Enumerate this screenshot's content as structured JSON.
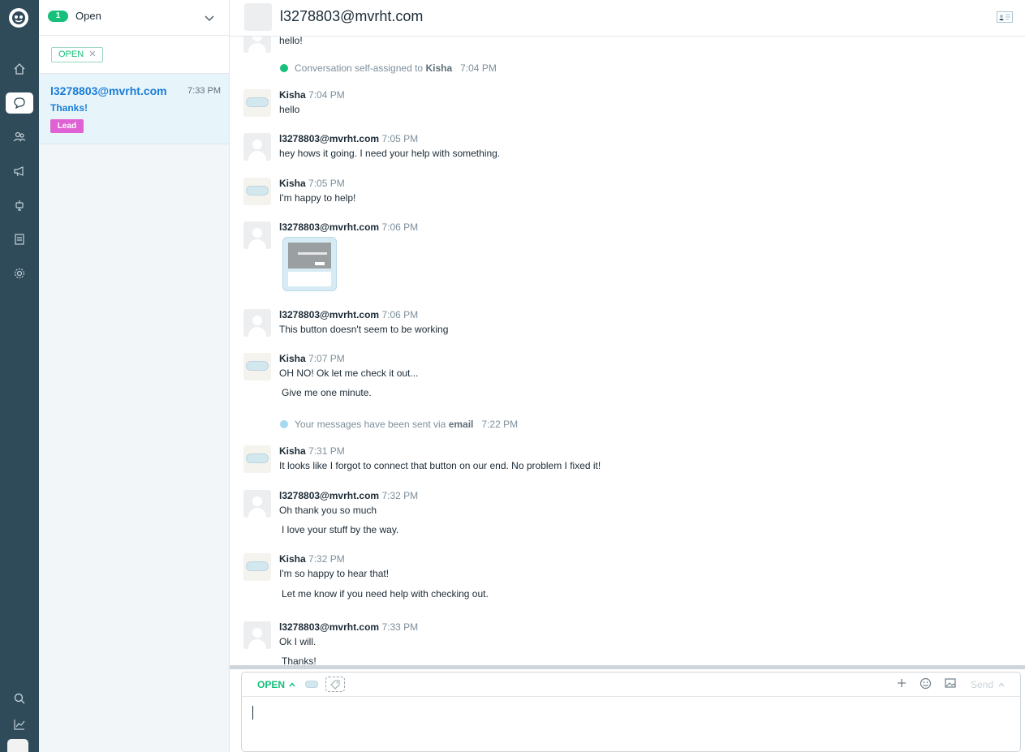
{
  "sidebar": {
    "logo_icon": "logo-icon",
    "items": [
      {
        "name": "home",
        "icon": "home-icon"
      },
      {
        "name": "inbox",
        "icon": "chat-icon",
        "active": true
      },
      {
        "name": "people",
        "icon": "people-icon"
      },
      {
        "name": "campaigns",
        "icon": "megaphone-icon"
      },
      {
        "name": "bots",
        "icon": "bot-icon"
      },
      {
        "name": "articles",
        "icon": "book-icon"
      },
      {
        "name": "settings",
        "icon": "gear-icon"
      }
    ],
    "bottom": [
      {
        "name": "search",
        "icon": "search-icon"
      },
      {
        "name": "reports",
        "icon": "chart-icon"
      }
    ]
  },
  "list": {
    "count": "1",
    "status_label": "Open",
    "filter_chip": "OPEN",
    "filter_chip_close": "✕",
    "conversations": [
      {
        "email": "l3278803@mvrht.com",
        "time": "7:33 PM",
        "preview": "Thanks!",
        "tag": "Lead"
      }
    ]
  },
  "header": {
    "title": "l3278803@mvrht.com"
  },
  "thread": {
    "partial_top": "hello!",
    "system_assigned": {
      "text": "Conversation self-assigned to",
      "who": "Kisha",
      "time": "7:04 PM"
    },
    "messages": [
      {
        "author": "Kisha",
        "time": "7:04 PM",
        "lines": [
          "hello"
        ]
      },
      {
        "author": "l3278803@mvrht.com",
        "time": "7:05 PM",
        "lines": [
          "hey hows it going. I need your help with something."
        ]
      },
      {
        "author": "Kisha",
        "time": "7:05 PM",
        "lines": [
          "I'm happy to help!"
        ]
      },
      {
        "author": "l3278803@mvrht.com",
        "time": "7:06 PM",
        "lines": []
      },
      {
        "author": "l3278803@mvrht.com",
        "time": "7:06 PM",
        "lines": [
          "This button doesn't seem to be working"
        ]
      },
      {
        "author": "Kisha",
        "time": "7:07 PM",
        "lines": [
          "OH NO! Ok let me check it out...",
          "Give me one minute."
        ]
      },
      {
        "author": "Kisha",
        "time": "7:31 PM",
        "lines": [
          "It looks like I forgot to connect that button on our end. No problem I fixed it!"
        ]
      },
      {
        "author": "l3278803@mvrht.com",
        "time": "7:32 PM",
        "lines": [
          "Oh thank you so much",
          "I love your stuff by the way."
        ]
      },
      {
        "author": "Kisha",
        "time": "7:32 PM",
        "lines": [
          "I'm so happy to hear that!",
          "Let me know if you need help with checking out."
        ]
      },
      {
        "author": "l3278803@mvrht.com",
        "time": "7:33 PM",
        "lines": [
          "Ok I will.",
          "Thanks!"
        ]
      }
    ],
    "system_email": {
      "text": "Your messages have been sent via",
      "channel": "email",
      "time": "7:22 PM"
    }
  },
  "composer": {
    "status": "OPEN",
    "send_label": "Send",
    "text": ""
  },
  "colors": {
    "rail": "#2f4b5a",
    "accent_green": "#16c07a",
    "link_blue": "#1a7dd6",
    "lead_pink": "#e061d3",
    "system_email_dot": "#a4d9ef"
  }
}
